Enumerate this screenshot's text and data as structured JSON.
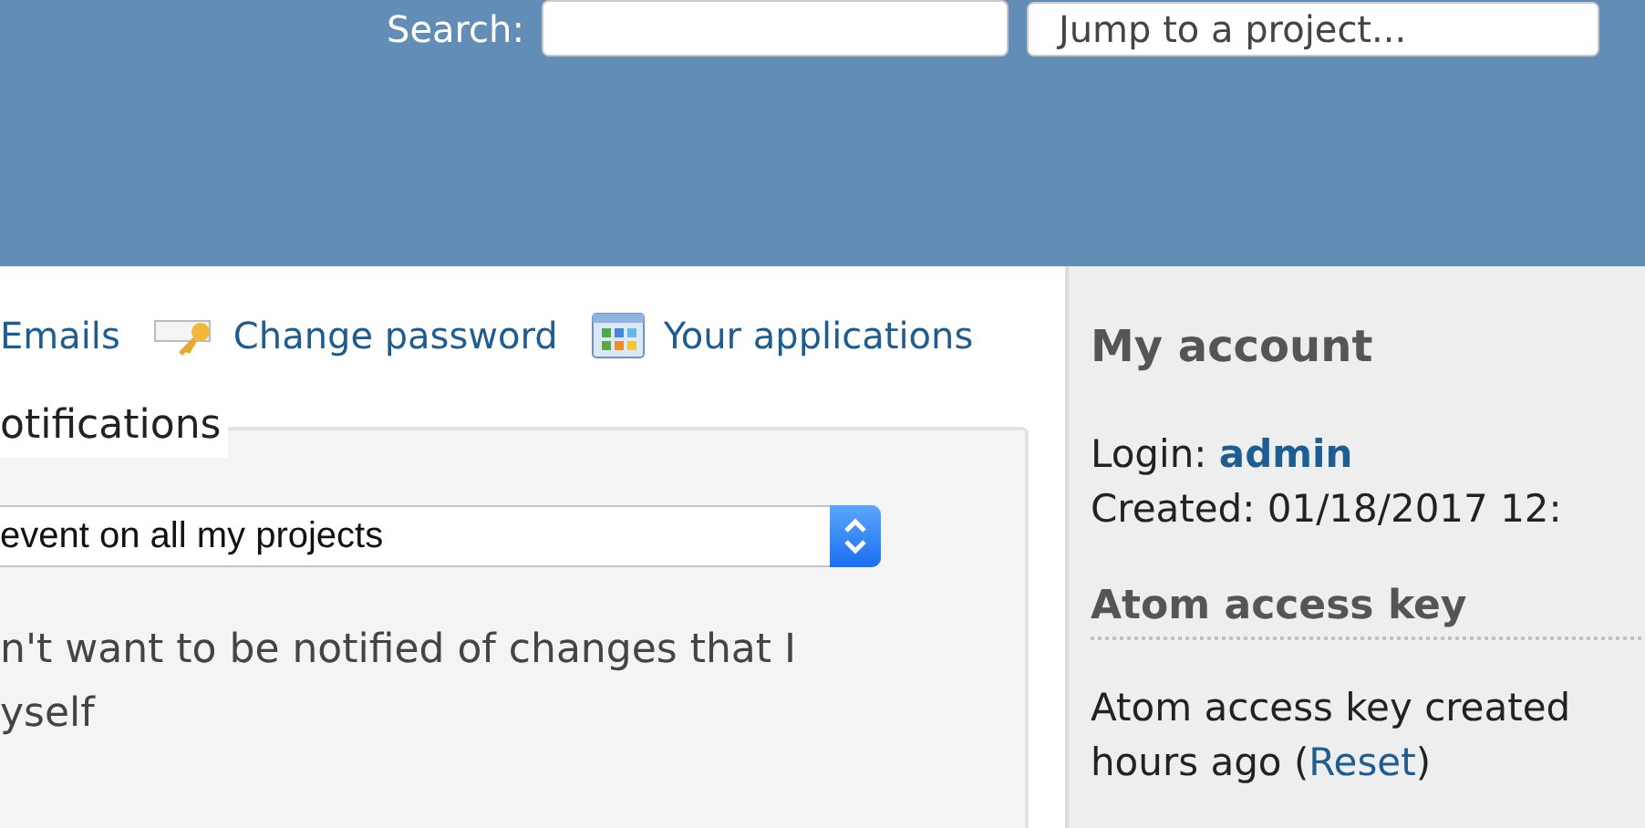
{
  "header": {
    "search_label": "Search:",
    "jump": {
      "placeholder": "Jump to a project..."
    }
  },
  "links": [
    {
      "label": "Emails",
      "kind": "plain"
    },
    {
      "label": "Change password",
      "kind": "password"
    },
    {
      "label": "Your applications",
      "kind": "applications"
    }
  ],
  "notifications": {
    "legend": "otifications",
    "select": {
      "value": "event on all my projects"
    },
    "note_lines": [
      "n't want to be notified of changes that I",
      "yself"
    ]
  },
  "sidebar": {
    "title": "My account",
    "login_label": "Login:",
    "login": "admin",
    "created": "Created: 01/18/2017 12:",
    "atom_title": "Atom access key",
    "atom_line1": "Atom access key created",
    "atom_line2_prefix": "hours ago (",
    "atom_reset": "Reset",
    "atom_line2_suffix": ")"
  }
}
